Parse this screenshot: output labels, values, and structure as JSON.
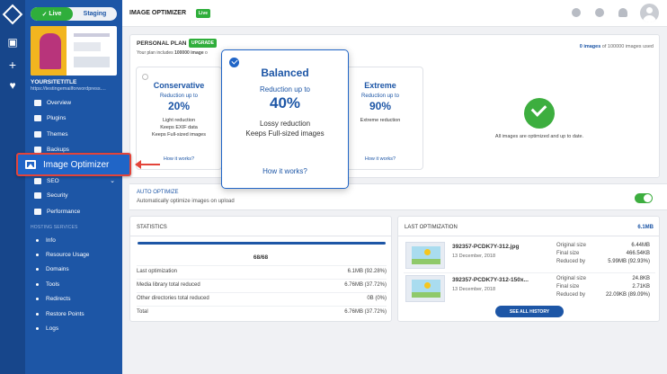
{
  "env": {
    "live": "Live",
    "staging": "Staging"
  },
  "site": {
    "name": "YOURSITETITLE",
    "url": "https://testingemailforwordpress...."
  },
  "nav": [
    {
      "label": "Overview",
      "icon": "grid-icon"
    },
    {
      "label": "Plugins",
      "icon": "plug-icon"
    },
    {
      "label": "Themes",
      "icon": "brush-icon"
    },
    {
      "label": "Backups",
      "icon": "box-icon"
    },
    {
      "label": "SEO",
      "icon": "chart-icon"
    },
    {
      "label": "Security",
      "icon": "shield-icon"
    },
    {
      "label": "Performance",
      "icon": "gauge-icon"
    }
  ],
  "hosting_section": "HOSTING SERVICES",
  "hosting": [
    "Info",
    "Resource Usage",
    "Domains",
    "Tools",
    "Redirects",
    "Restore Points",
    "Logs"
  ],
  "highlight": {
    "label": "Image Optimizer"
  },
  "header": {
    "title": "IMAGE OPTIMIZER",
    "badge": "Live"
  },
  "plan": {
    "title": "PERSONAL PLAN",
    "upgrade": "UPGRADE",
    "desc_prefix": "Your plan includes ",
    "desc_bold": "100000 image",
    "desc_suffix": " o",
    "used_bold": "0 images",
    "used_rest": " of 100000 images used"
  },
  "options": [
    {
      "name": "Conservative",
      "reduction": "Reduction up to",
      "percent": "20%",
      "features": [
        "Light reduction",
        "Keeps EXIF data",
        "Keeps Full-sized images"
      ],
      "how": "How it works?"
    },
    {
      "name": "Extreme",
      "reduction": "Reduction up to",
      "percent": "90%",
      "features": [
        "Extreme reduction"
      ],
      "how": "How it works?"
    }
  ],
  "popup": {
    "name": "Balanced",
    "reduction": "Reduction up to",
    "percent": "40%",
    "feature1": "Lossy reduction",
    "feature2": "Keeps Full-sized images",
    "how": "How it works?"
  },
  "status_text": "All images are optimized and up to date.",
  "auto": {
    "title": "AUTO OPTIMIZE",
    "desc": "Automatically optimize images on upload",
    "enabled": true
  },
  "stats": {
    "title": "STATISTICS",
    "progress": "68/68",
    "rows": [
      {
        "label": "Last optimization",
        "value": "6.1MB (92.28%)"
      },
      {
        "label": "Media library total reduced",
        "value": "6.76MB (37.72%)"
      },
      {
        "label": "Other directories total reduced",
        "value": "0B (0%)"
      },
      {
        "label": "Total",
        "value": "6.76MB (37.72%)"
      }
    ]
  },
  "last": {
    "title": "LAST OPTIMIZATION",
    "total": "6.1MB",
    "items": [
      {
        "file": "392357-PCDK7Y-312.jpg",
        "date": "13 December, 2018",
        "k1": "Original size",
        "v1": "6.44MB",
        "k2": "Final size",
        "v2": "466.54KB",
        "k3": "Reduced by",
        "v3": "5.99MB (92.93%)"
      },
      {
        "file": "392357-PCDK7Y-312-150x...",
        "date": "13 December, 2018",
        "k1": "Original size",
        "v1": "24.8KB",
        "k2": "Final size",
        "v2": "2.71KB",
        "k3": "Reduced by",
        "v3": "22.09KB (89.09%)"
      }
    ],
    "see_all": "SEE ALL HISTORY"
  },
  "colors": {
    "primary": "#1d56a6",
    "green": "#2fae3b",
    "highlight_border": "#e3443a"
  }
}
